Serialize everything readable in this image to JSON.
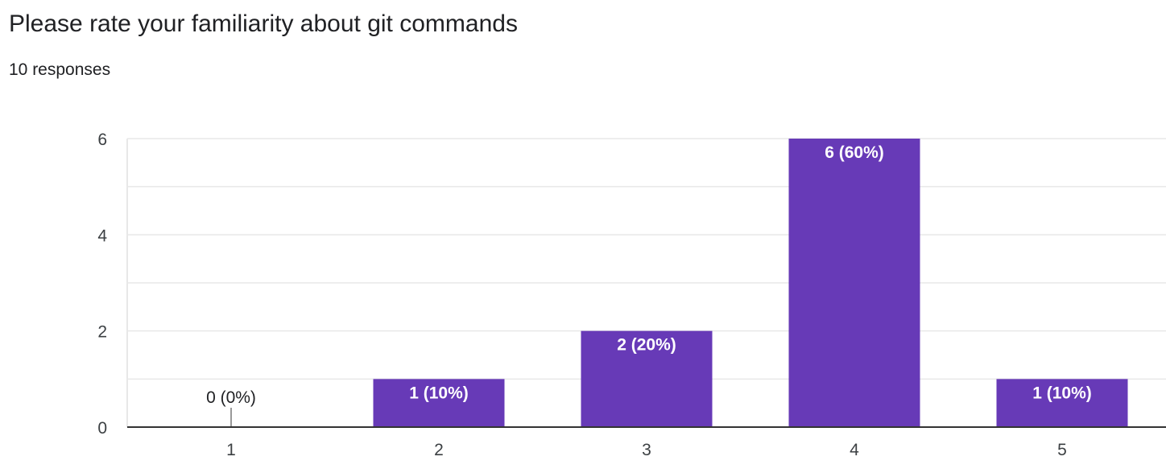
{
  "question": {
    "title": "Please rate your familiarity about git commands",
    "responses": "10 responses"
  },
  "colors": {
    "bar": "#673ab7",
    "grid": "#e8e8e8",
    "axis": "#333333",
    "label_inside": "#ffffff",
    "label_outside": "#202124"
  },
  "chart_data": {
    "type": "bar",
    "categories": [
      "1",
      "2",
      "3",
      "4",
      "5"
    ],
    "values": [
      0,
      1,
      2,
      6,
      1
    ],
    "data_labels": [
      "0 (0%)",
      "1 (10%)",
      "2 (20%)",
      "6 (60%)",
      "1 (10%)"
    ],
    "title": "",
    "xlabel": "",
    "ylabel": "",
    "ylim": [
      0,
      6
    ],
    "yticks": [
      0,
      2,
      4,
      6
    ],
    "grid": true,
    "legend": "none"
  }
}
